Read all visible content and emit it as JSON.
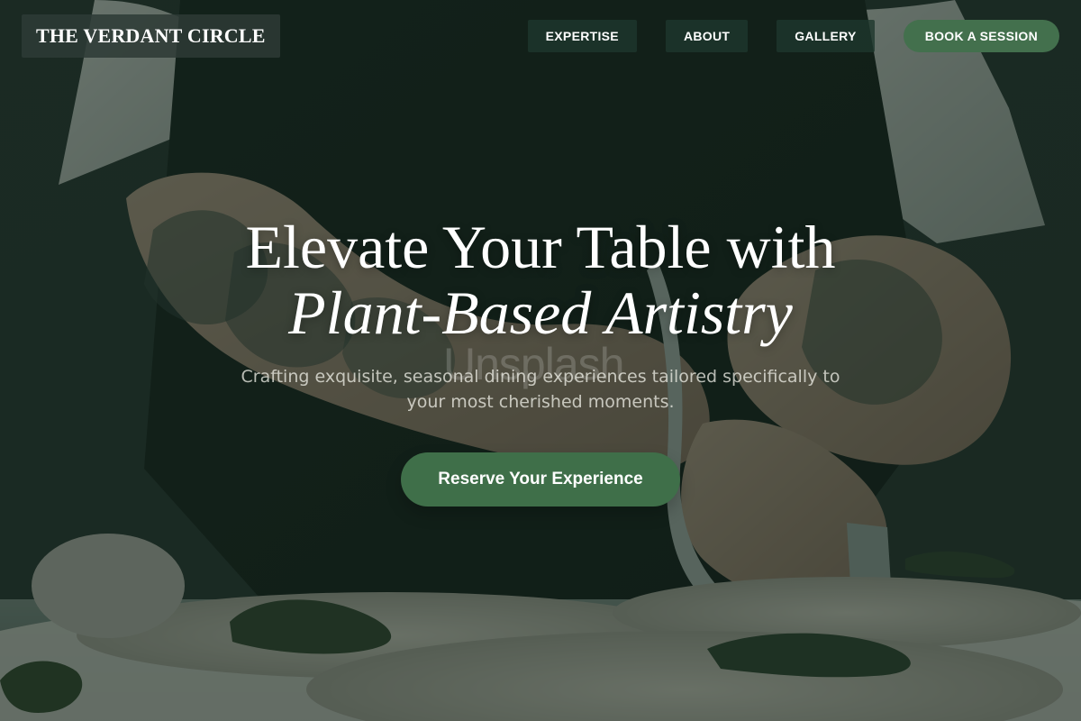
{
  "site": {
    "brand": "THE VERDANT CIRCLE",
    "accent_color": "#43704d",
    "hero_overlay_color": "#1e2d25"
  },
  "nav": {
    "items": [
      {
        "label": "EXPERTISE"
      },
      {
        "label": "ABOUT"
      },
      {
        "label": "GALLERY"
      }
    ],
    "book_button_label": "BOOK A SESSION"
  },
  "hero": {
    "title_line1": "Elevate Your Table with",
    "title_line2": "Plant-Based Artistry",
    "subtitle": "Crafting exquisite, seasonal dining experiences tailored specifically to your most cherished moments.",
    "cta_label": "Reserve Your Experience",
    "watermark_text": "Unsplash"
  },
  "icons": {
    "background": "chef-plating-image"
  }
}
